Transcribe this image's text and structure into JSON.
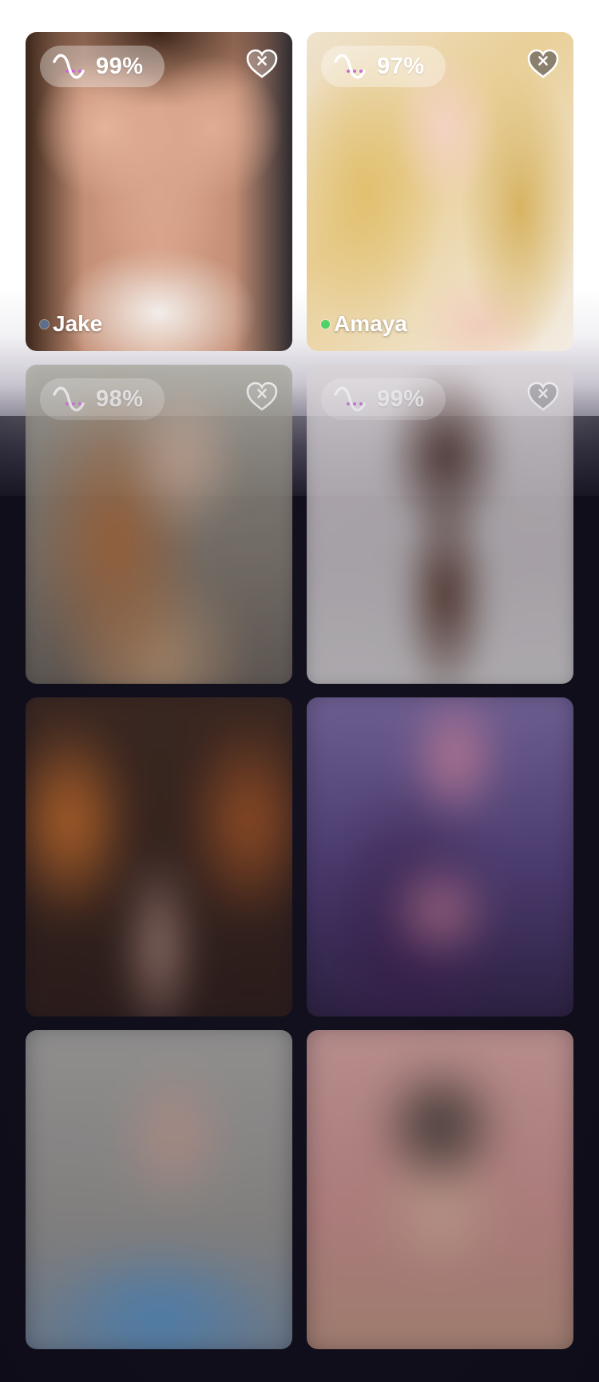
{
  "profiles": [
    {
      "name": "Jake",
      "match": "99%",
      "online": false,
      "status_color": "#5b6f8c"
    },
    {
      "name": "Amaya",
      "match": "97%",
      "online": true,
      "status_color": "#4ed26a"
    },
    {
      "match": "98%"
    },
    {
      "match": "99%"
    }
  ],
  "icons": {
    "match_wave": "wave-dots-icon",
    "favorite": "heart-close-icon"
  },
  "colors": {
    "background_dark": "#14111f",
    "accent_dots": "#c86bd6",
    "online": "#4ed26a",
    "offline": "#5b6f8c"
  }
}
